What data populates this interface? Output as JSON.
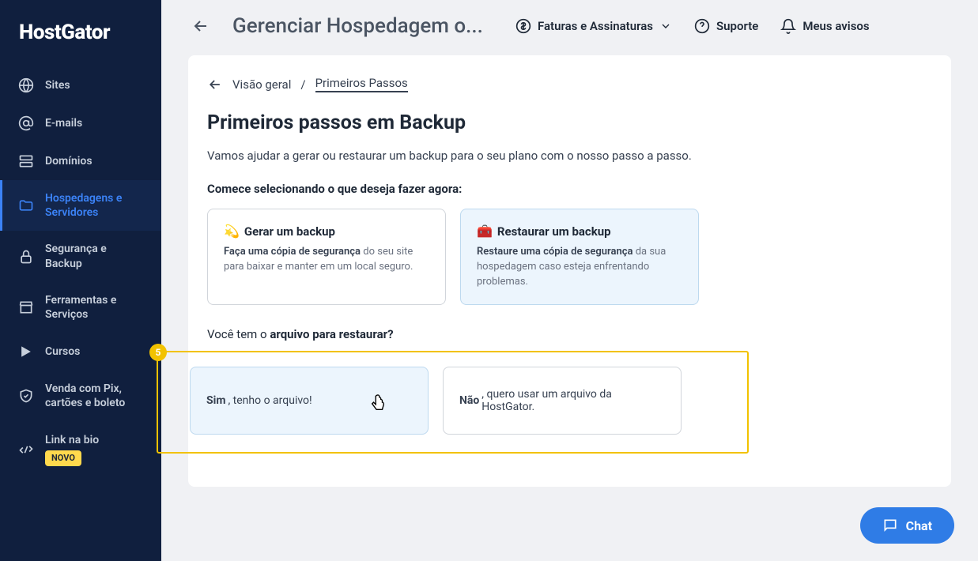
{
  "logo": "HostGator",
  "sidebar": {
    "items": [
      {
        "label": "Sites"
      },
      {
        "label": "E-mails"
      },
      {
        "label": "Domínios"
      },
      {
        "label": "Hospedagens e Servidores"
      },
      {
        "label": "Segurança e Backup"
      },
      {
        "label": "Ferramentas e Serviços"
      },
      {
        "label": "Cursos"
      },
      {
        "label": "Venda com Pix, cartões e boleto"
      },
      {
        "label": "Link na bio"
      }
    ],
    "novo_badge": "NOVO"
  },
  "header": {
    "title": "Gerenciar Hospedagem o...",
    "billing": "Faturas e Assinaturas",
    "support": "Suporte",
    "notices": "Meus avisos"
  },
  "breadcrumb": {
    "root": "Visão geral",
    "separator": "/",
    "current": "Primeiros Passos"
  },
  "page": {
    "title": "Primeiros passos em Backup",
    "subtitle": "Vamos ajudar a gerar ou restaurar um backup para o seu plano com o nosso passo a passo.",
    "section_label": "Comece selecionando o que deseja fazer agora:"
  },
  "options": {
    "generate": {
      "emoji": "💫",
      "title": "Gerar um backup",
      "desc_bold": "Faça uma cópia de segurança",
      "desc_rest": " do seu site para baixar e manter em um local seguro."
    },
    "restore": {
      "emoji": "🧰",
      "title": "Restaurar um backup",
      "desc_bold": "Restaure uma cópia de segurança",
      "desc_rest": " da sua hospedagem caso esteja enfrentando problemas."
    }
  },
  "question": {
    "prefix": "Você tem o ",
    "bold": "arquivo para restaurar?"
  },
  "highlight": {
    "number": "5"
  },
  "answers": {
    "yes_bold": "Sim",
    "yes_rest": ", tenho o arquivo!",
    "no_bold": "Não",
    "no_rest": ", quero usar um arquivo da HostGator."
  },
  "chat": {
    "label": "Chat"
  }
}
